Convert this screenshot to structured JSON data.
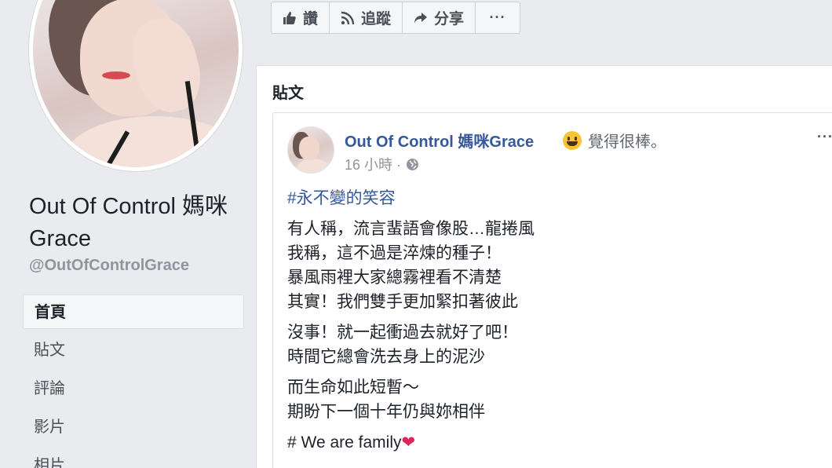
{
  "page": {
    "name": "Out Of Control 媽咪Grace",
    "handle": "@OutOfControlGrace"
  },
  "left_nav": [
    {
      "label": "首頁",
      "active": true
    },
    {
      "label": "貼文"
    },
    {
      "label": "評論"
    },
    {
      "label": "影片"
    },
    {
      "label": "相片"
    }
  ],
  "actions": {
    "like": "讚",
    "follow": "追蹤",
    "share": "分享",
    "more": "···"
  },
  "posts_section": {
    "title": "貼文"
  },
  "post": {
    "author": "Out Of Control 媽咪Grace",
    "feeling_emoji": "smiling-face",
    "feeling_text": "覺得很棒。",
    "time": "16 小時 ·",
    "menu": "···",
    "hashtag": "#永不變的笑容",
    "paragraphs": [
      [
        "有人稱，流言蜚語會像股…龍捲風",
        "我稱，這不過是淬煉的種子！",
        "暴風雨裡大家總霧裡看不清楚",
        "其實！我們雙手更加緊扣著彼此"
      ],
      [
        "沒事！就一起衝過去就好了吧！",
        "時間它總會洗去身上的泥沙"
      ],
      [
        "而生命如此短暫～",
        "期盼下一個十年仍與妳相伴"
      ]
    ],
    "closing_text": "# We are family",
    "closing_emoji": "❤"
  },
  "colors": {
    "background": "#e9ebee",
    "link": "#365899",
    "muted": "#90949c",
    "heart": "#e0245e"
  }
}
